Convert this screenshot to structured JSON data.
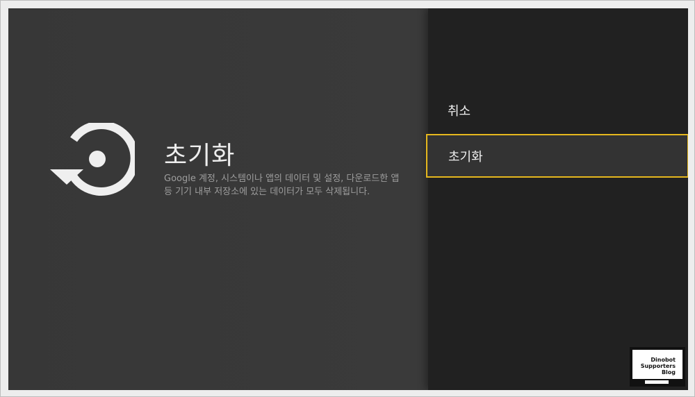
{
  "detail": {
    "title": "초기화",
    "description": "Google 계정, 시스템이나 앱의 데이터 및 설정, 다운로드한 앱 등 기기 내부 저장소에 있는 데이터가 모두 삭제됩니다."
  },
  "menu": {
    "items": [
      {
        "label": "취소",
        "selected": false
      },
      {
        "label": "초기화",
        "selected": true
      }
    ]
  },
  "icons": {
    "reset": "restore-icon"
  },
  "colors": {
    "focus_border": "#e6b81e",
    "left_pane_bg": "#3a3a3a",
    "right_pane_bg": "#212121"
  },
  "watermark": {
    "line1": "Dinobot",
    "line2": "Supporters",
    "line3": "Blog"
  }
}
